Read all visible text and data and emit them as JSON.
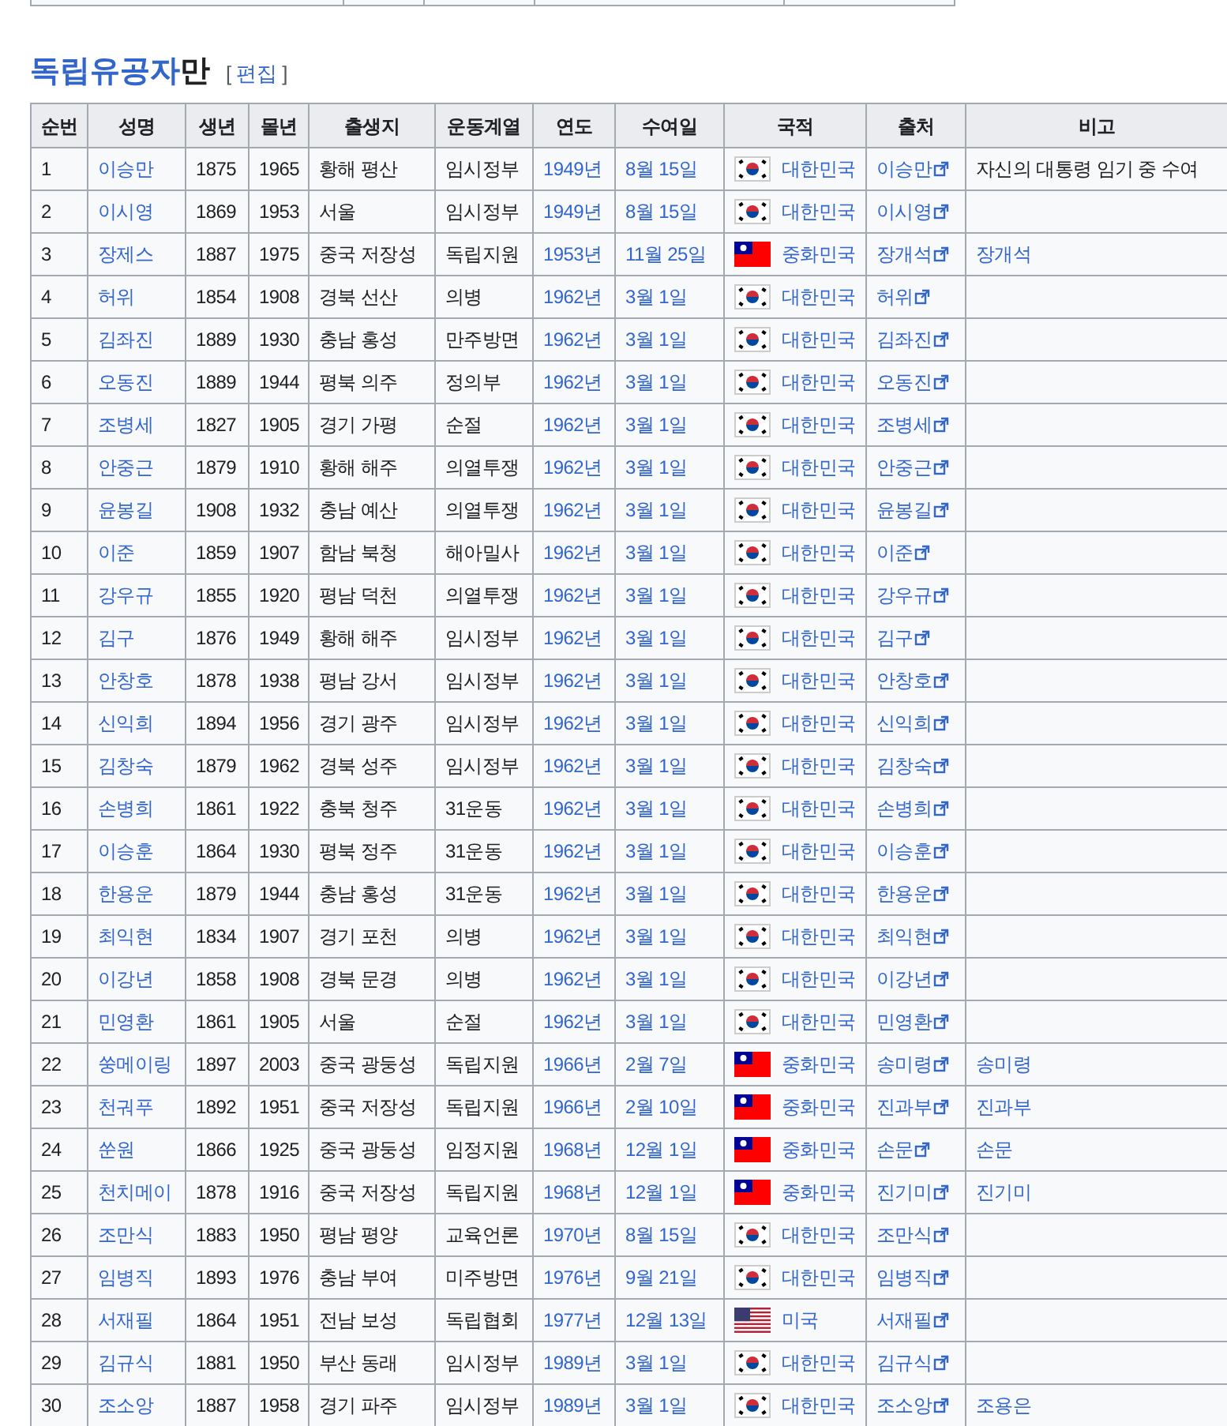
{
  "heading": {
    "title_link": "독립유공자",
    "title_rest": "만",
    "bracket_open": "[",
    "edit_link": "편집",
    "bracket_close": "]"
  },
  "table": {
    "columns": [
      "순번",
      "성명",
      "생년",
      "몰년",
      "출생지",
      "운동계열",
      "연도",
      "수여일",
      "국적",
      "출처",
      "비고"
    ],
    "rows": [
      {
        "no": "1",
        "name": "이승만",
        "born": "1875",
        "died": "1965",
        "birthplace": "황해 평산",
        "movement": "임시정부",
        "year": "1949년",
        "date": "8월 15일",
        "nationality": {
          "kind": "kr",
          "label": "대한민국"
        },
        "source": "이승만",
        "note": {
          "kind": "text",
          "label": "자신의 대통령 임기 중 수여"
        }
      },
      {
        "no": "2",
        "name": "이시영",
        "born": "1869",
        "died": "1953",
        "birthplace": "서울",
        "movement": "임시정부",
        "year": "1949년",
        "date": "8월 15일",
        "nationality": {
          "kind": "kr",
          "label": "대한민국"
        },
        "source": "이시영"
      },
      {
        "no": "3",
        "name": "장제스",
        "born": "1887",
        "died": "1975",
        "birthplace": "중국 저장성",
        "movement": "독립지원",
        "year": "1953년",
        "date": "11월 25일",
        "nationality": {
          "kind": "roc",
          "label": "중화민국"
        },
        "source": "장개석",
        "note": {
          "kind": "link",
          "label": "장개석"
        }
      },
      {
        "no": "4",
        "name": "허위",
        "born": "1854",
        "died": "1908",
        "birthplace": "경북 선산",
        "movement": "의병",
        "year": "1962년",
        "date": "3월 1일",
        "nationality": {
          "kind": "kr",
          "label": "대한민국"
        },
        "source": "허위"
      },
      {
        "no": "5",
        "name": "김좌진",
        "born": "1889",
        "died": "1930",
        "birthplace": "충남 홍성",
        "movement": "만주방면",
        "year": "1962년",
        "date": "3월 1일",
        "nationality": {
          "kind": "kr",
          "label": "대한민국"
        },
        "source": "김좌진"
      },
      {
        "no": "6",
        "name": "오동진",
        "born": "1889",
        "died": "1944",
        "birthplace": "평북 의주",
        "movement": "정의부",
        "year": "1962년",
        "date": "3월 1일",
        "nationality": {
          "kind": "kr",
          "label": "대한민국"
        },
        "source": "오동진"
      },
      {
        "no": "7",
        "name": "조병세",
        "born": "1827",
        "died": "1905",
        "birthplace": "경기 가평",
        "movement": "순절",
        "year": "1962년",
        "date": "3월 1일",
        "nationality": {
          "kind": "kr",
          "label": "대한민국"
        },
        "source": "조병세"
      },
      {
        "no": "8",
        "name": "안중근",
        "born": "1879",
        "died": "1910",
        "birthplace": "황해 해주",
        "movement": "의열투쟁",
        "year": "1962년",
        "date": "3월 1일",
        "nationality": {
          "kind": "kr",
          "label": "대한민국"
        },
        "source": "안중근"
      },
      {
        "no": "9",
        "name": "윤봉길",
        "born": "1908",
        "died": "1932",
        "birthplace": "충남 예산",
        "movement": "의열투쟁",
        "year": "1962년",
        "date": "3월 1일",
        "nationality": {
          "kind": "kr",
          "label": "대한민국"
        },
        "source": "윤봉길"
      },
      {
        "no": "10",
        "name": "이준",
        "born": "1859",
        "died": "1907",
        "birthplace": "함남 북청",
        "movement": "해아밀사",
        "year": "1962년",
        "date": "3월 1일",
        "nationality": {
          "kind": "kr",
          "label": "대한민국"
        },
        "source": "이준"
      },
      {
        "no": "11",
        "name": "강우규",
        "born": "1855",
        "died": "1920",
        "birthplace": "평남 덕천",
        "movement": "의열투쟁",
        "year": "1962년",
        "date": "3월 1일",
        "nationality": {
          "kind": "kr",
          "label": "대한민국"
        },
        "source": "강우규"
      },
      {
        "no": "12",
        "name": "김구",
        "born": "1876",
        "died": "1949",
        "birthplace": "황해 해주",
        "movement": "임시정부",
        "year": "1962년",
        "date": "3월 1일",
        "nationality": {
          "kind": "kr",
          "label": "대한민국"
        },
        "source": "김구"
      },
      {
        "no": "13",
        "name": "안창호",
        "born": "1878",
        "died": "1938",
        "birthplace": "평남 강서",
        "movement": "임시정부",
        "year": "1962년",
        "date": "3월 1일",
        "nationality": {
          "kind": "kr",
          "label": "대한민국"
        },
        "source": "안창호"
      },
      {
        "no": "14",
        "name": "신익희",
        "born": "1894",
        "died": "1956",
        "birthplace": "경기 광주",
        "movement": "임시정부",
        "year": "1962년",
        "date": "3월 1일",
        "nationality": {
          "kind": "kr",
          "label": "대한민국"
        },
        "source": "신익희"
      },
      {
        "no": "15",
        "name": "김창숙",
        "born": "1879",
        "died": "1962",
        "birthplace": "경북 성주",
        "movement": "임시정부",
        "year": "1962년",
        "date": "3월 1일",
        "nationality": {
          "kind": "kr",
          "label": "대한민국"
        },
        "source": "김창숙"
      },
      {
        "no": "16",
        "name": "손병희",
        "born": "1861",
        "died": "1922",
        "birthplace": "충북 청주",
        "movement": "31운동",
        "year": "1962년",
        "date": "3월 1일",
        "nationality": {
          "kind": "kr",
          "label": "대한민국"
        },
        "source": "손병희"
      },
      {
        "no": "17",
        "name": "이승훈",
        "born": "1864",
        "died": "1930",
        "birthplace": "평북 정주",
        "movement": "31운동",
        "year": "1962년",
        "date": "3월 1일",
        "nationality": {
          "kind": "kr",
          "label": "대한민국"
        },
        "source": "이승훈"
      },
      {
        "no": "18",
        "name": "한용운",
        "born": "1879",
        "died": "1944",
        "birthplace": "충남 홍성",
        "movement": "31운동",
        "year": "1962년",
        "date": "3월 1일",
        "nationality": {
          "kind": "kr",
          "label": "대한민국"
        },
        "source": "한용운"
      },
      {
        "no": "19",
        "name": "최익현",
        "born": "1834",
        "died": "1907",
        "birthplace": "경기 포천",
        "movement": "의병",
        "year": "1962년",
        "date": "3월 1일",
        "nationality": {
          "kind": "kr",
          "label": "대한민국"
        },
        "source": "최익현"
      },
      {
        "no": "20",
        "name": "이강년",
        "born": "1858",
        "died": "1908",
        "birthplace": "경북 문경",
        "movement": "의병",
        "year": "1962년",
        "date": "3월 1일",
        "nationality": {
          "kind": "kr",
          "label": "대한민국"
        },
        "source": "이강년"
      },
      {
        "no": "21",
        "name": "민영환",
        "born": "1861",
        "died": "1905",
        "birthplace": "서울",
        "movement": "순절",
        "year": "1962년",
        "date": "3월 1일",
        "nationality": {
          "kind": "kr",
          "label": "대한민국"
        },
        "source": "민영환"
      },
      {
        "no": "22",
        "name": "쑹메이링",
        "born": "1897",
        "died": "2003",
        "birthplace": "중국 광둥성",
        "movement": "독립지원",
        "year": "1966년",
        "date": "2월 7일",
        "nationality": {
          "kind": "roc",
          "label": "중화민국"
        },
        "source": "송미령",
        "note": {
          "kind": "link",
          "label": "송미령"
        }
      },
      {
        "no": "23",
        "name": "천궈푸",
        "born": "1892",
        "died": "1951",
        "birthplace": "중국 저장성",
        "movement": "독립지원",
        "year": "1966년",
        "date": "2월 10일",
        "nationality": {
          "kind": "roc",
          "label": "중화민국"
        },
        "source": "진과부",
        "note": {
          "kind": "link",
          "label": "진과부"
        }
      },
      {
        "no": "24",
        "name": "쑨원",
        "born": "1866",
        "died": "1925",
        "birthplace": "중국 광둥성",
        "movement": "임정지원",
        "year": "1968년",
        "date": "12월 1일",
        "nationality": {
          "kind": "roc",
          "label": "중화민국"
        },
        "source": "손문",
        "note": {
          "kind": "link",
          "label": "손문"
        }
      },
      {
        "no": "25",
        "name": "천치메이",
        "born": "1878",
        "died": "1916",
        "birthplace": "중국 저장성",
        "movement": "독립지원",
        "year": "1968년",
        "date": "12월 1일",
        "nationality": {
          "kind": "roc",
          "label": "중화민국"
        },
        "source": "진기미",
        "note": {
          "kind": "link",
          "label": "진기미"
        }
      },
      {
        "no": "26",
        "name": "조만식",
        "born": "1883",
        "died": "1950",
        "birthplace": "평남 평양",
        "movement": "교육언론",
        "year": "1970년",
        "date": "8월 15일",
        "nationality": {
          "kind": "kr",
          "label": "대한민국"
        },
        "source": "조만식"
      },
      {
        "no": "27",
        "name": "임병직",
        "born": "1893",
        "died": "1976",
        "birthplace": "충남 부여",
        "movement": "미주방면",
        "year": "1976년",
        "date": "9월 21일",
        "nationality": {
          "kind": "kr",
          "label": "대한민국"
        },
        "source": "임병직"
      },
      {
        "no": "28",
        "name": "서재필",
        "born": "1864",
        "died": "1951",
        "birthplace": "전남 보성",
        "movement": "독립협회",
        "year": "1977년",
        "date": "12월 13일",
        "nationality": {
          "kind": "us",
          "label": "미국"
        },
        "source": "서재필"
      },
      {
        "no": "29",
        "name": "김규식",
        "born": "1881",
        "died": "1950",
        "birthplace": "부산 동래",
        "movement": "임시정부",
        "year": "1989년",
        "date": "3월 1일",
        "nationality": {
          "kind": "kr",
          "label": "대한민국"
        },
        "source": "김규식"
      },
      {
        "no": "30",
        "name": "조소앙",
        "born": "1887",
        "died": "1958",
        "birthplace": "경기 파주",
        "movement": "임시정부",
        "year": "1989년",
        "date": "3월 1일",
        "nationality": {
          "kind": "kr",
          "label": "대한민국"
        },
        "source": "조소앙",
        "note": {
          "kind": "link",
          "label": "조용은"
        }
      }
    ]
  }
}
